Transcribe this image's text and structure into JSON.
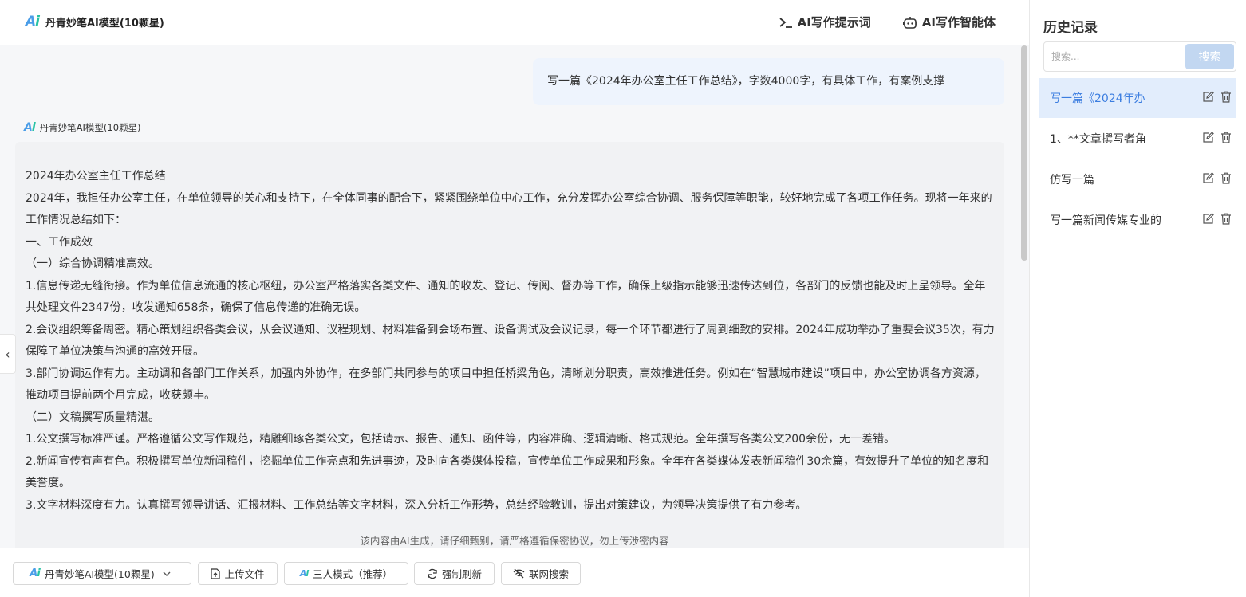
{
  "header": {
    "brand_name": "丹青妙笔AI模型(10颗星)",
    "links": [
      {
        "label": "AI写作提示词",
        "icon": "terminal-icon"
      },
      {
        "label": "AI写作智能体",
        "icon": "robot-icon"
      }
    ]
  },
  "chat": {
    "user_message": "写一篇《2024年办公室主任工作总结》，字数4000字，有具体工作，有案例支撑",
    "ai_label": "丹青妙笔AI模型(10颗星)",
    "ai_paragraphs": [
      "2024年办公室主任工作总结",
      "2024年，我担任办公室主任，在单位领导的关心和支持下，在全体同事的配合下，紧紧围绕单位中心工作，充分发挥办公室综合协调、服务保障等职能，较好地完成了各项工作任务。现将一年来的工作情况总结如下：",
      "一、工作成效",
      "（一）综合协调精准高效。",
      "1.信息传递无缝衔接。作为单位信息流通的核心枢纽，办公室严格落实各类文件、通知的收发、登记、传阅、督办等工作，确保上级指示能够迅速传达到位，各部门的反馈也能及时上呈领导。全年共处理文件2347份，收发通知658条，确保了信息传递的准确无误。",
      "2.会议组织筹备周密。精心策划组织各类会议，从会议通知、议程规划、材料准备到会场布置、设备调试及会议记录，每一个环节都进行了周到细致的安排。2024年成功举办了重要会议35次，有力保障了单位决策与沟通的高效开展。",
      "3.部门协调运作有力。主动调和各部门工作关系，加强内外协作，在多部门共同参与的项目中担任桥梁角色，清晰划分职责，高效推进任务。例如在“智慧城市建设”项目中，办公室协调各方资源，推动项目提前两个月完成，收获颇丰。",
      "（二）文稿撰写质量精湛。",
      "1.公文撰写标准严谨。严格遵循公文写作规范，精雕细琢各类公文，包括请示、报告、通知、函件等，内容准确、逻辑清晰、格式规范。全年撰写各类公文200余份，无一差错。",
      "2.新闻宣传有声有色。积极撰写单位新闻稿件，挖掘单位工作亮点和先进事迹，及时向各类媒体投稿，宣传单位工作成果和形象。全年在各类媒体发表新闻稿件30余篇，有效提升了单位的知名度和美誉度。",
      "3.文字材料深度有力。认真撰写领导讲话、汇报材料、工作总结等文字材料，深入分析工作形势，总结经验教训，提出对策建议，为领导决策提供了有力参考。"
    ],
    "disclaimer": "该内容由AI生成，请仔细甄别，请严格遵循保密协议，勿上传涉密内容"
  },
  "toolbar": {
    "model_select": "丹青妙笔AI模型(10颗星)",
    "upload_label": "上传文件",
    "mode_label": "三人模式（推荐）",
    "refresh_label": "强制刷新",
    "web_search_label": "联网搜索"
  },
  "sidebar": {
    "title": "历史记录",
    "search_placeholder": "搜索...",
    "search_button": "搜索",
    "items": [
      {
        "label": "写一篇《2024年办",
        "active": true
      },
      {
        "label": "1、**文章撰写者角",
        "active": false
      },
      {
        "label": "仿写一篇",
        "active": false
      },
      {
        "label": "写一篇新闻传媒专业的",
        "active": false
      }
    ]
  },
  "colors": {
    "accent": "#3b7de0",
    "active_bg": "#e2edfc",
    "search_button_bg": "#c2d7f1",
    "logo_blue": "#4a9de8",
    "logo_teal": "#27c2a4"
  }
}
